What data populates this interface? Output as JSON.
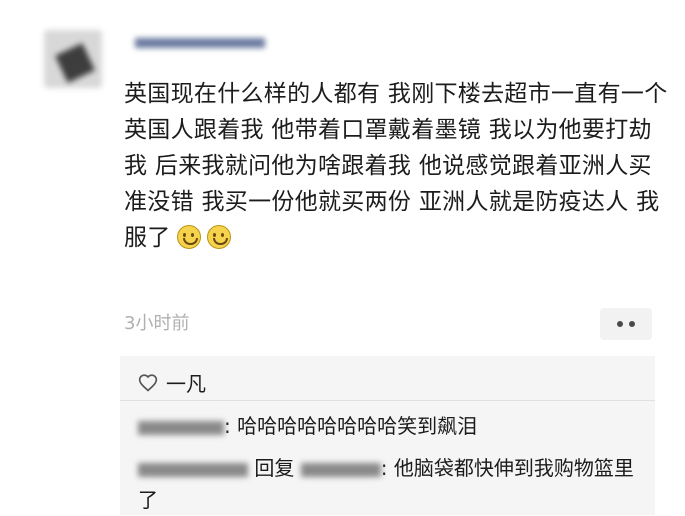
{
  "post": {
    "text": "英国现在什么样的人都有 我刚下楼去超市一直有一个英国人跟着我 他带着口罩戴着墨镜 我以为他要打劫我 后来我就问他为啥跟着我 他说感觉跟着亚洲人买准没错 我买一份他就买两份 亚洲人就是防疫达人 我服了",
    "emojis": [
      "smile-emoji",
      "smile-emoji"
    ],
    "timestamp": "3小时前"
  },
  "likes": {
    "icon": "heart-icon",
    "names": "一凡"
  },
  "comments": [
    {
      "text": ": 哈哈哈哈哈哈哈哈笑到飙泪"
    },
    {
      "reply_label": "回复",
      "text": ": 他脑袋都快伸到我购物篮里了"
    }
  ]
}
